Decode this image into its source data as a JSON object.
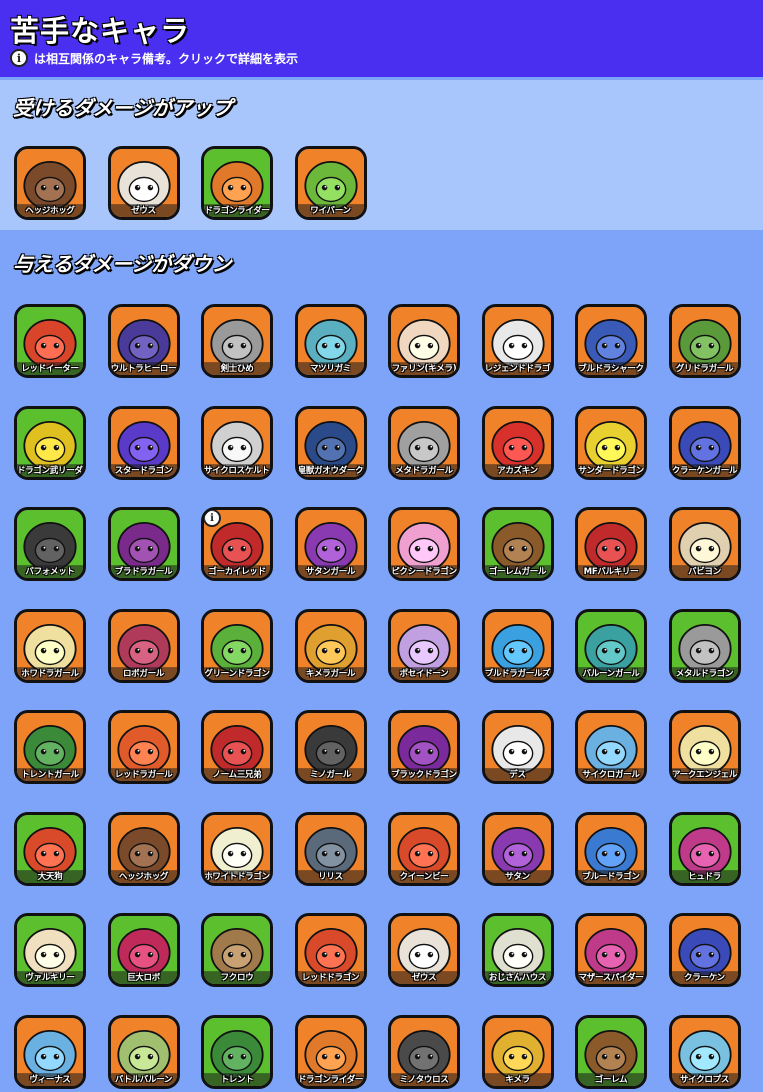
{
  "header": {
    "title": "苦手なキャラ",
    "info_glyph": "i",
    "note": "は相互関係のキャラ備考。クリックで詳細を表示"
  },
  "sections": [
    {
      "title": "受けるダメージがアップ",
      "characters": [
        {
          "name": "ヘッジホッグ",
          "bg": "orange",
          "color": "#7a4a2a"
        },
        {
          "name": "ゼウス",
          "bg": "orange",
          "color": "#e8e2d8"
        },
        {
          "name": "ドラゴンライダー",
          "bg": "green",
          "color": "#e07a2a"
        },
        {
          "name": "ワイバーン",
          "bg": "orange",
          "color": "#6cb83a"
        }
      ]
    },
    {
      "title": "与えるダメージがダウン",
      "characters": [
        {
          "name": "レッドイーター",
          "bg": "green",
          "color": "#d8452a"
        },
        {
          "name": "ウルトラヒーロー",
          "bg": "orange",
          "color": "#4a3a9a"
        },
        {
          "name": "剣士ひめ",
          "bg": "orange",
          "color": "#9a9a9a"
        },
        {
          "name": "マツリガミ",
          "bg": "orange",
          "color": "#5ab0c0"
        },
        {
          "name": "ファリン(キメラ)",
          "bg": "orange",
          "color": "#f0d8c0"
        },
        {
          "name": "レジェンドドラゴン",
          "bg": "orange",
          "color": "#e8e8e8"
        },
        {
          "name": "ブルドラシャーク",
          "bg": "orange",
          "color": "#3a5ab8"
        },
        {
          "name": "グリドラガール",
          "bg": "orange",
          "color": "#5a9a3a"
        },
        {
          "name": "ドラゴン武リーダー",
          "bg": "green",
          "color": "#e0c020"
        },
        {
          "name": "スタードラゴン",
          "bg": "orange",
          "color": "#5a3ac8"
        },
        {
          "name": "サイクロスケルトン",
          "bg": "orange",
          "color": "#d0d0d0"
        },
        {
          "name": "皇獣ガオウダーク",
          "bg": "orange",
          "color": "#2a4a8a"
        },
        {
          "name": "メタドラガール",
          "bg": "orange",
          "color": "#a0a0a0"
        },
        {
          "name": "アカズキン",
          "bg": "orange",
          "color": "#d8302a"
        },
        {
          "name": "サンダードラゴン",
          "bg": "orange",
          "color": "#e8d030"
        },
        {
          "name": "クラーケンガール",
          "bg": "orange",
          "color": "#3a4ab8"
        },
        {
          "name": "バフォメット",
          "bg": "green",
          "color": "#3a3a3a"
        },
        {
          "name": "ブラドラガール",
          "bg": "green",
          "color": "#7a2a8a"
        },
        {
          "name": "ゴーカイレッド",
          "bg": "orange",
          "color": "#c02a2a",
          "badge": true
        },
        {
          "name": "サタンガール",
          "bg": "orange",
          "color": "#8a3ab0"
        },
        {
          "name": "ピクシードラゴン",
          "bg": "orange",
          "color": "#f0a0d0"
        },
        {
          "name": "ゴーレムガール",
          "bg": "green",
          "color": "#8a5a2a"
        },
        {
          "name": "MFバルキリー",
          "bg": "orange",
          "color": "#c02a2a"
        },
        {
          "name": "バビヨン",
          "bg": "orange",
          "color": "#e0d0b0"
        },
        {
          "name": "ホワドラガール",
          "bg": "orange",
          "color": "#f0e0a0"
        },
        {
          "name": "ロボガール",
          "bg": "orange",
          "color": "#b03a5a"
        },
        {
          "name": "グリーンドラゴン",
          "bg": "orange",
          "color": "#5ab03a"
        },
        {
          "name": "キメラガール",
          "bg": "orange",
          "color": "#e0a030"
        },
        {
          "name": "ポセイドーン",
          "bg": "orange",
          "color": "#c0a0e0"
        },
        {
          "name": "ブルドラガールズ",
          "bg": "orange",
          "color": "#3aa0e0"
        },
        {
          "name": "バルーンガール",
          "bg": "green",
          "color": "#3aa0a0"
        },
        {
          "name": "メタルドラゴン",
          "bg": "green",
          "color": "#9a9a9a"
        },
        {
          "name": "トレントガール",
          "bg": "orange",
          "color": "#3a8a3a"
        },
        {
          "name": "レッドラガール",
          "bg": "orange",
          "color": "#e05a2a"
        },
        {
          "name": "ノーム三兄弟",
          "bg": "orange",
          "color": "#c02a2a"
        },
        {
          "name": "ミノガール",
          "bg": "orange",
          "color": "#3a3a3a"
        },
        {
          "name": "ブラックドラゴン",
          "bg": "orange",
          "color": "#7a2a9a"
        },
        {
          "name": "デス",
          "bg": "orange",
          "color": "#e8e8e8"
        },
        {
          "name": "サイクロガール",
          "bg": "orange",
          "color": "#6ab0e0"
        },
        {
          "name": "アークエンジェル",
          "bg": "orange",
          "color": "#f0e0a0"
        },
        {
          "name": "大天狗",
          "bg": "green",
          "color": "#d84a2a"
        },
        {
          "name": "ヘッジホッグ",
          "bg": "orange",
          "color": "#7a4a2a"
        },
        {
          "name": "ホワイトドラゴン",
          "bg": "orange",
          "color": "#f0f0d0"
        },
        {
          "name": "リリス",
          "bg": "orange",
          "color": "#5a6a7a"
        },
        {
          "name": "クイーンビー",
          "bg": "orange",
          "color": "#d84a2a"
        },
        {
          "name": "サタン",
          "bg": "orange",
          "color": "#8a3ab0"
        },
        {
          "name": "ブルードラゴン",
          "bg": "orange",
          "color": "#3a7ad0"
        },
        {
          "name": "ヒュドラ",
          "bg": "green",
          "color": "#c03a8a"
        },
        {
          "name": "ヴァルキリー",
          "bg": "green",
          "color": "#f0e0c0"
        },
        {
          "name": "巨大ロボ",
          "bg": "green",
          "color": "#c02a5a"
        },
        {
          "name": "フクロウ",
          "bg": "green",
          "color": "#a07a4a"
        },
        {
          "name": "レッドドラゴン",
          "bg": "orange",
          "color": "#d84a2a"
        },
        {
          "name": "ゼウス",
          "bg": "orange",
          "color": "#e8e2d8"
        },
        {
          "name": "おじさんハウス",
          "bg": "green",
          "color": "#e0e0d0"
        },
        {
          "name": "マザースパイダー",
          "bg": "orange",
          "color": "#c03a8a"
        },
        {
          "name": "クラーケン",
          "bg": "orange",
          "color": "#3a4ab8"
        },
        {
          "name": "ヴィーナス",
          "bg": "orange",
          "color": "#6ab0e0"
        },
        {
          "name": "バトルバルーン",
          "bg": "orange",
          "color": "#a0c070"
        },
        {
          "name": "トレント",
          "bg": "green",
          "color": "#3a8a3a"
        },
        {
          "name": "ドラゴンライダー",
          "bg": "orange",
          "color": "#e07a2a"
        },
        {
          "name": "ミノタウロス",
          "bg": "orange",
          "color": "#4a4a4a"
        },
        {
          "name": "キメラ",
          "bg": "orange",
          "color": "#e0b030"
        },
        {
          "name": "ゴーレム",
          "bg": "green",
          "color": "#8a5a2a"
        },
        {
          "name": "サイクロプス",
          "bg": "orange",
          "color": "#7ac0e0"
        }
      ]
    }
  ],
  "colors": {
    "header_bg": "#4a2ff0",
    "section1_bg": "#a9c6fc",
    "section2_bg": "#7da4f8",
    "card_orange": "#f0822a",
    "card_green": "#5cbf2e"
  }
}
